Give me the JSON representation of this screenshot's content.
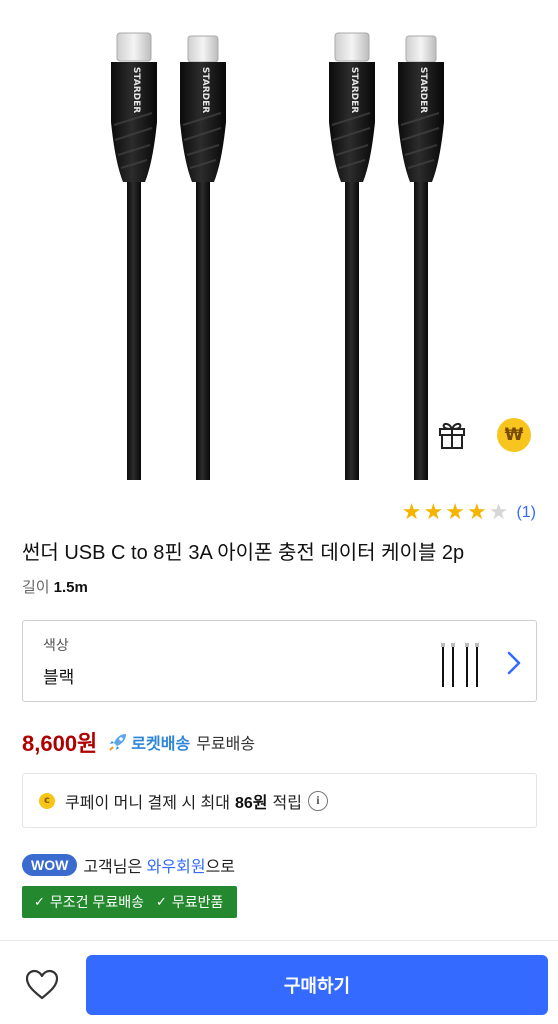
{
  "hero": {
    "cable_brand": "STARDER"
  },
  "rating": {
    "stars_filled": 4,
    "stars_total": 5,
    "count": "(1)"
  },
  "product": {
    "title": "썬더 USB C to 8핀 3A 아이폰 충전 데이터 케이블 2p",
    "spec_key": "길이",
    "spec_value": "1.5m"
  },
  "option": {
    "label": "색상",
    "value": "블랙"
  },
  "price": {
    "amount": "8,600원",
    "rocket_label": "로켓배송",
    "shipping": "무료배송"
  },
  "cash": {
    "coin_glyph": "c",
    "text": "쿠페이 머니 결제 시 최대",
    "amount": "86원",
    "suffix": "적립",
    "info_glyph": "i"
  },
  "wow": {
    "badge": "WOW",
    "prefix": "고객님은",
    "link": "와우회원",
    "suffix": "으로"
  },
  "benefits": [
    "무조건 무료배송",
    "무료반품"
  ],
  "bottom": {
    "buy_label": "구매하기"
  },
  "icons": {
    "gift": "gift-icon",
    "cash_reward": "won-coin-icon",
    "chevron": "chevron-right-icon",
    "heart": "heart-icon",
    "rocket": "rocket-icon",
    "info": "info-icon",
    "check": "check-icon"
  },
  "colors": {
    "accent": "#346aff",
    "price": "#ae0000",
    "star": "#f5b400",
    "benefit_bg": "#23882e",
    "wow_bg": "#3b6bcf",
    "rocket": "#2f86d8"
  }
}
